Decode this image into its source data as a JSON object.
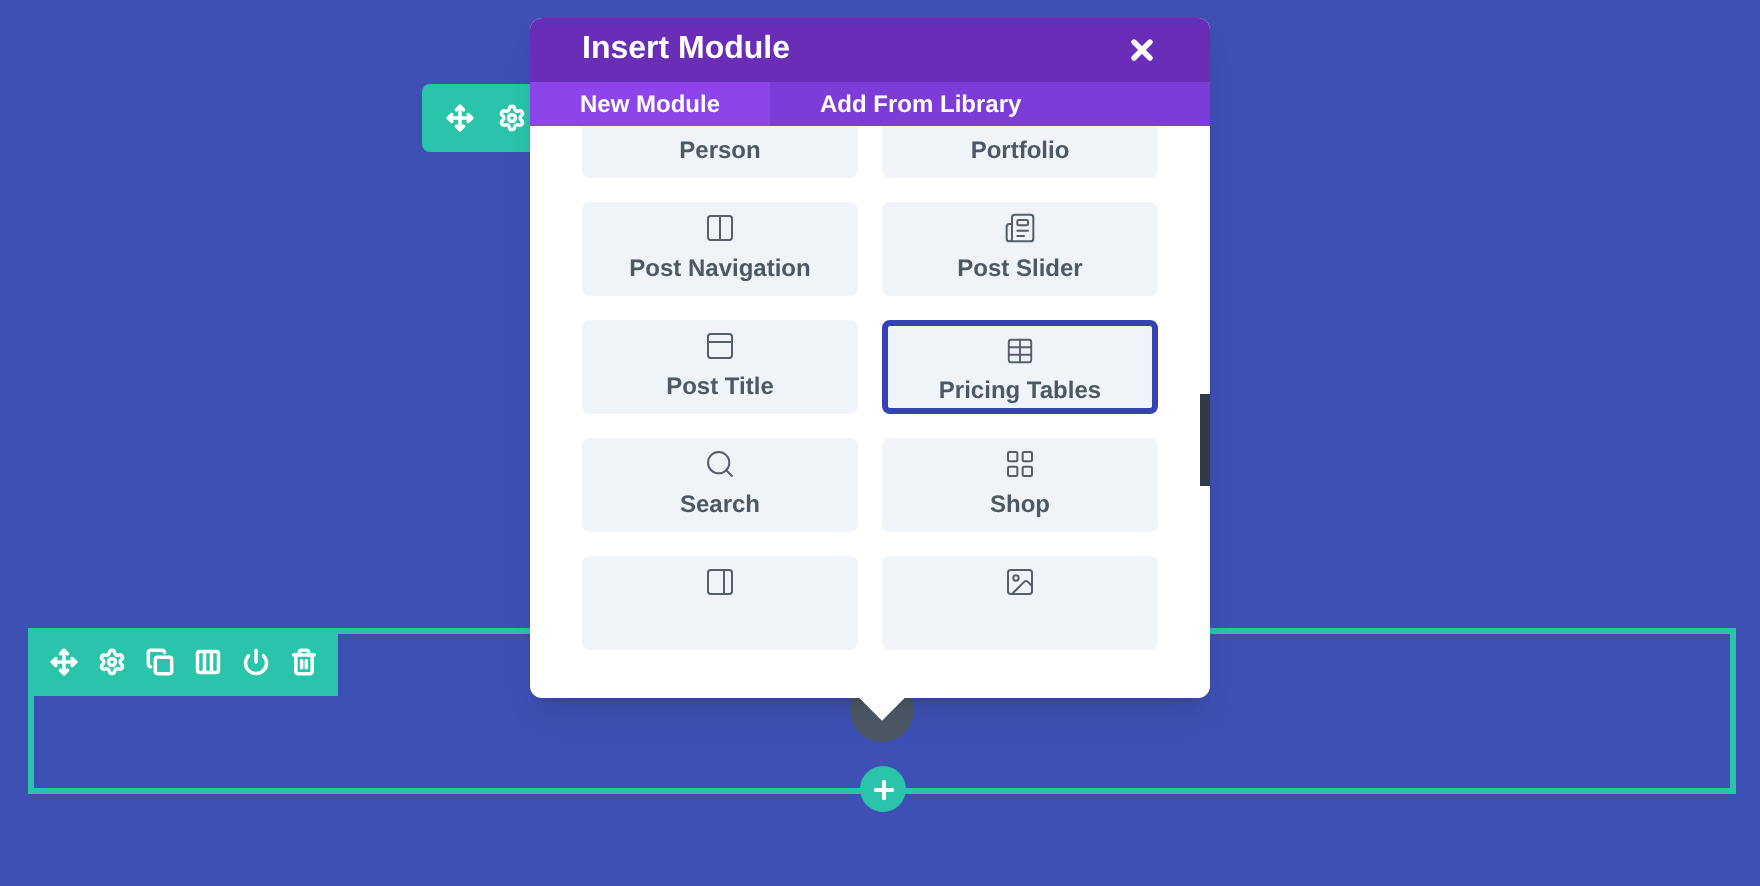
{
  "modal": {
    "title": "Insert Module",
    "tabs": [
      {
        "label": "New Module",
        "selected": true
      },
      {
        "label": "Add From Library",
        "selected": false
      }
    ],
    "modules": [
      {
        "label": "Person",
        "selected": false
      },
      {
        "label": "Portfolio",
        "selected": false
      },
      {
        "label": "Post Navigation",
        "selected": false
      },
      {
        "label": "Post Slider",
        "selected": false
      },
      {
        "label": "Post Title",
        "selected": false
      },
      {
        "label": "Pricing Tables",
        "selected": true
      },
      {
        "label": "Search",
        "selected": false
      },
      {
        "label": "Shop",
        "selected": false
      },
      {
        "selected": false
      },
      {
        "selected": false
      }
    ]
  }
}
